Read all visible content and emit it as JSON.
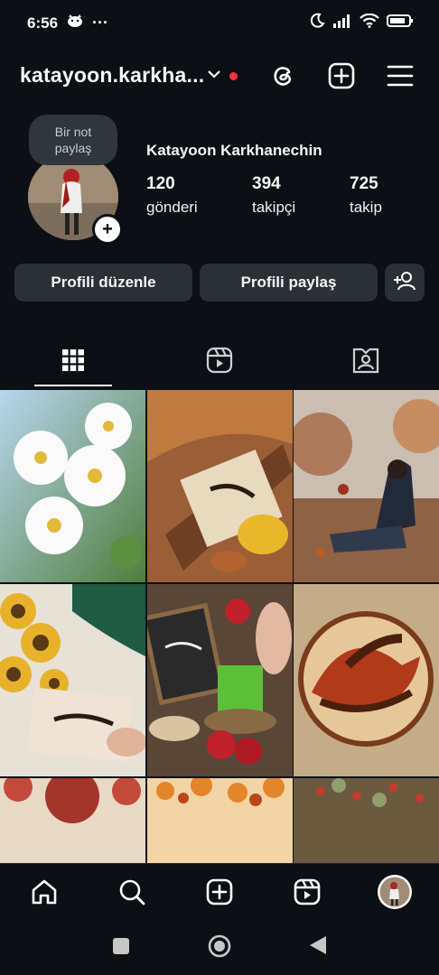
{
  "status_bar": {
    "time": "6:56",
    "more": "···"
  },
  "header": {
    "username": "katayoon.karkha...",
    "icons": [
      "threads-icon",
      "create-post-icon",
      "menu-icon"
    ]
  },
  "profile": {
    "note_line1": "Bir not",
    "note_line2": "paylaş",
    "full_name": "Katayoon Karkhanechin",
    "stats": [
      {
        "value": "120",
        "label": "gönderi"
      },
      {
        "value": "394",
        "label": "takipçi"
      },
      {
        "value": "725",
        "label": "takip"
      }
    ]
  },
  "actions": {
    "edit_profile": "Profili düzenle",
    "share_profile": "Profili paylaş"
  },
  "tabs": [
    "posts-grid-icon",
    "reels-icon",
    "tagged-icon"
  ],
  "posts": [
    {
      "theme": "white-flowers",
      "color": "#9fc3e0"
    },
    {
      "theme": "autumn-leaf-card",
      "color": "#a2673a"
    },
    {
      "theme": "woman-autumn",
      "color": "#b4a89a"
    },
    {
      "theme": "sunflowers-card",
      "color": "#e6b33a"
    },
    {
      "theme": "sabzeh-apples",
      "color": "#5e4a3a"
    },
    {
      "theme": "calligraphy-madar",
      "color": "#c9b38c"
    },
    {
      "theme": "pomegranate",
      "color": "#a5352a"
    },
    {
      "theme": "autumn-trees",
      "color": "#e79a3b"
    },
    {
      "theme": "fruit-tree",
      "color": "#6b5a40"
    }
  ],
  "bottom_nav": [
    "home-icon",
    "search-icon",
    "create-icon",
    "reels-icon",
    "profile-avatar"
  ]
}
